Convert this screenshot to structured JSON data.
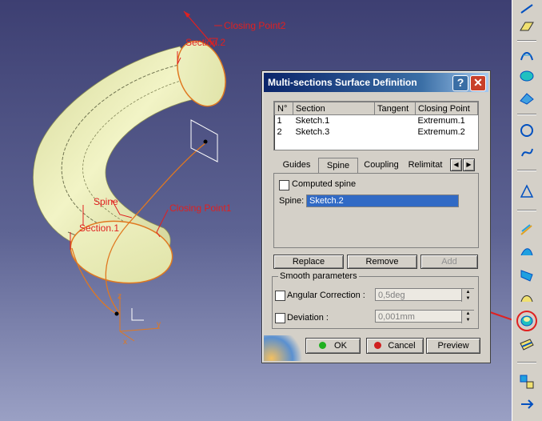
{
  "viewport": {
    "labels": {
      "closing_point2": "Closing Point2",
      "section2": "Section.2",
      "spine": "Spine",
      "closing_point1": "Closing Point1",
      "section1": "Section.1"
    },
    "axes": {
      "x": "x",
      "y": "y",
      "z": "z"
    },
    "surface_color": "#e8ebae",
    "label_color": "#e02020"
  },
  "dialog": {
    "title": "Multi-sections Surface Definition",
    "help_icon": "help-icon",
    "close_icon": "close-icon",
    "table": {
      "headers": [
        "N°",
        "Section",
        "Tangent",
        "Closing Point"
      ],
      "rows": [
        {
          "n": "1",
          "section": "Sketch.1",
          "tangent": "",
          "closing": "Extremum.1"
        },
        {
          "n": "2",
          "section": "Sketch.3",
          "tangent": "",
          "closing": "Extremum.2"
        }
      ]
    },
    "tabs": [
      "Guides",
      "Spine",
      "Coupling",
      "Relimitat"
    ],
    "active_tab": "Spine",
    "computed_spine_label": "Computed spine",
    "spine_label": "Spine:",
    "spine_value": "Sketch.2",
    "buttons": {
      "replace": "Replace",
      "remove": "Remove",
      "add": "Add"
    },
    "smooth": {
      "title": "Smooth parameters",
      "angular_label": "Angular Correction :",
      "angular_value": "0,5deg",
      "deviation_label": "Deviation :",
      "deviation_value": "0,001mm"
    },
    "ok": "OK",
    "cancel": "Cancel",
    "preview": "Preview"
  },
  "toolbar": {
    "highlight_color": "#e02020",
    "highlighted_icon": "multi-sections-surface-icon"
  }
}
